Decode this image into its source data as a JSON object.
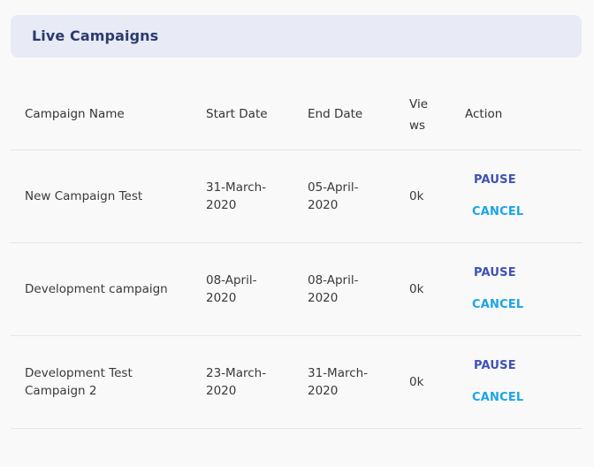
{
  "header": {
    "title": "Live Campaigns"
  },
  "table": {
    "columns": {
      "name": "Campaign Name",
      "start": "Start Date",
      "end": "End Date",
      "views": "Views",
      "action": "Action"
    },
    "rows": [
      {
        "name": "New Campaign Test",
        "start": "31-March-2020",
        "end": "05-April-2020",
        "views": "0k",
        "pause": "PAUSE",
        "cancel": "CANCEL"
      },
      {
        "name": "Development campaign",
        "start": "08-April-2020",
        "end": "08-April-2020",
        "views": "0k",
        "pause": "PAUSE",
        "cancel": "CANCEL"
      },
      {
        "name": "Development Test Campaign 2",
        "start": "23-March-2020",
        "end": "31-March-2020",
        "views": "0k",
        "pause": "PAUSE",
        "cancel": "CANCEL"
      }
    ]
  },
  "colors": {
    "header_bg": "#e8eaf6",
    "title": "#2c3a6e",
    "pause": "#3f51b5",
    "cancel": "#1aa5e8"
  }
}
